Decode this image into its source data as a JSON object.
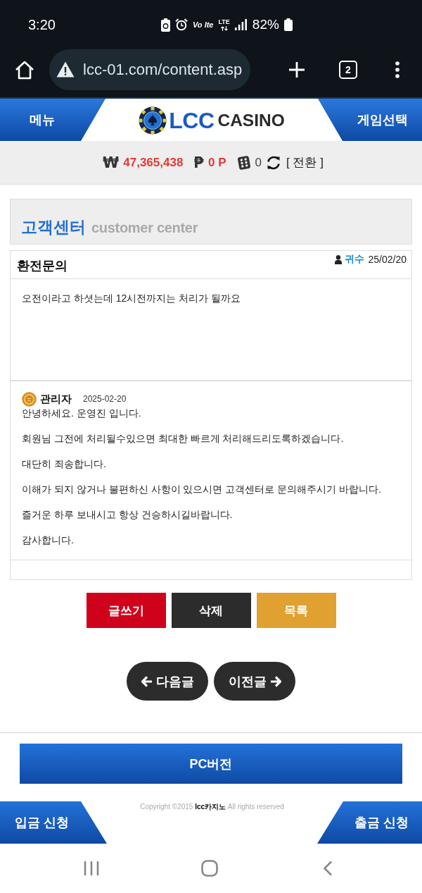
{
  "status_bar": {
    "time": "3:20",
    "volte": "Vo lte",
    "network": "LTE",
    "battery": "82%"
  },
  "browser": {
    "url": "lcc-01.com/content.asp",
    "tab_count": "2"
  },
  "header": {
    "menu": "메뉴",
    "logo_brand": "LCC",
    "logo_suffix": "CASINO",
    "game_select": "게임선택"
  },
  "balance": {
    "currency_symbol": "₩",
    "money": "47,365,438",
    "point_symbol": "₱",
    "points": "0 P",
    "chips": "0",
    "convert": "[ 전환 ]"
  },
  "section": {
    "title": "고객센터",
    "subtitle": "customer center"
  },
  "post": {
    "title": "환전문의",
    "author": "귀수",
    "date": "25/02/20",
    "body": "오전이라고 하셧는데 12시전까지는 처리가 될까요"
  },
  "reply": {
    "author": "관리자",
    "date": "2025-02-20",
    "paragraphs": [
      "안녕하세요. 운영진 입니다.",
      "회원님 그전에 처리될수있으면 최대한 빠르게 처리해드리도록하겠습니다.",
      "대단히 죄송합니다.",
      "이해가 되지 않거나 불편하신 사항이 있으시면 고객센터로 문의해주시기 바랍니다.",
      "즐거운 하루 보내시고 항상 건승하시길바랍니다.",
      "감사합니다."
    ]
  },
  "actions": [
    {
      "kind": "write",
      "label": "글쓰기"
    },
    {
      "kind": "delete",
      "label": "삭제"
    },
    {
      "kind": "list",
      "label": "목록"
    }
  ],
  "pager": [
    {
      "kind": "back",
      "label": "다음글"
    },
    {
      "kind": "forward",
      "label": "이전글"
    }
  ],
  "footer": {
    "pc_version": "PC버전",
    "copyright": "Copyright ©2015 **lcc카지노** All rights reserved",
    "deposit": "입금 신청",
    "withdraw": "출금 신청"
  }
}
